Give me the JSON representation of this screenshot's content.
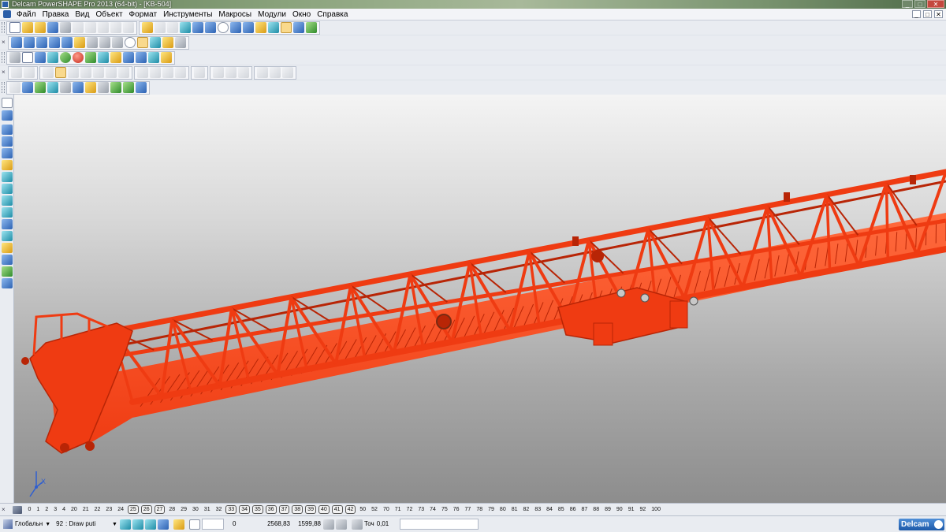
{
  "titlebar": {
    "title": "Delcam PowerSHAPE Pro 2013 (64-bit) - [KB-504]",
    "min_label": "_",
    "max_label": "□",
    "close_label": "✕"
  },
  "menu": {
    "items": [
      "Файл",
      "Правка",
      "Вид",
      "Объект",
      "Формат",
      "Инструменты",
      "Макросы",
      "Модули",
      "Окно",
      "Справка"
    ],
    "mdi_min": "_",
    "mdi_max": "□",
    "mdi_close": "✕"
  },
  "toolbars": {
    "close_glyph": "×"
  },
  "levels": {
    "close_glyph": "×",
    "items": [
      "0",
      "1",
      "2",
      "3",
      "4",
      "20",
      "21",
      "22",
      "23",
      "24",
      "25",
      "26",
      "27",
      "28",
      "29",
      "30",
      "31",
      "32",
      "33",
      "34",
      "35",
      "36",
      "37",
      "38",
      "39",
      "40",
      "41",
      "42",
      "50",
      "52",
      "70",
      "71",
      "72",
      "73",
      "74",
      "75",
      "76",
      "77",
      "78",
      "79",
      "80",
      "81",
      "82",
      "83",
      "84",
      "85",
      "86",
      "87",
      "88",
      "89",
      "90",
      "91",
      "92",
      "100"
    ],
    "active": [
      "25",
      "26",
      "27",
      "33",
      "34",
      "35",
      "36",
      "37",
      "38",
      "39",
      "40",
      "41",
      "42"
    ]
  },
  "status": {
    "workplane": "Глобальн",
    "level_number": "92",
    "level_name": ": Draw puti",
    "dropdown_arrow": "▼",
    "coord_x": "0",
    "coord_y": "2568,83",
    "coord_z": "1599,88",
    "tolerance_label": "Точ",
    "tolerance_value": "0,01",
    "brand": "Delcam"
  },
  "axis": {
    "x_label": "X"
  },
  "colors": {
    "model": "#ef3b12",
    "model_dark": "#b82506",
    "model_light": "#ff6a3d"
  }
}
